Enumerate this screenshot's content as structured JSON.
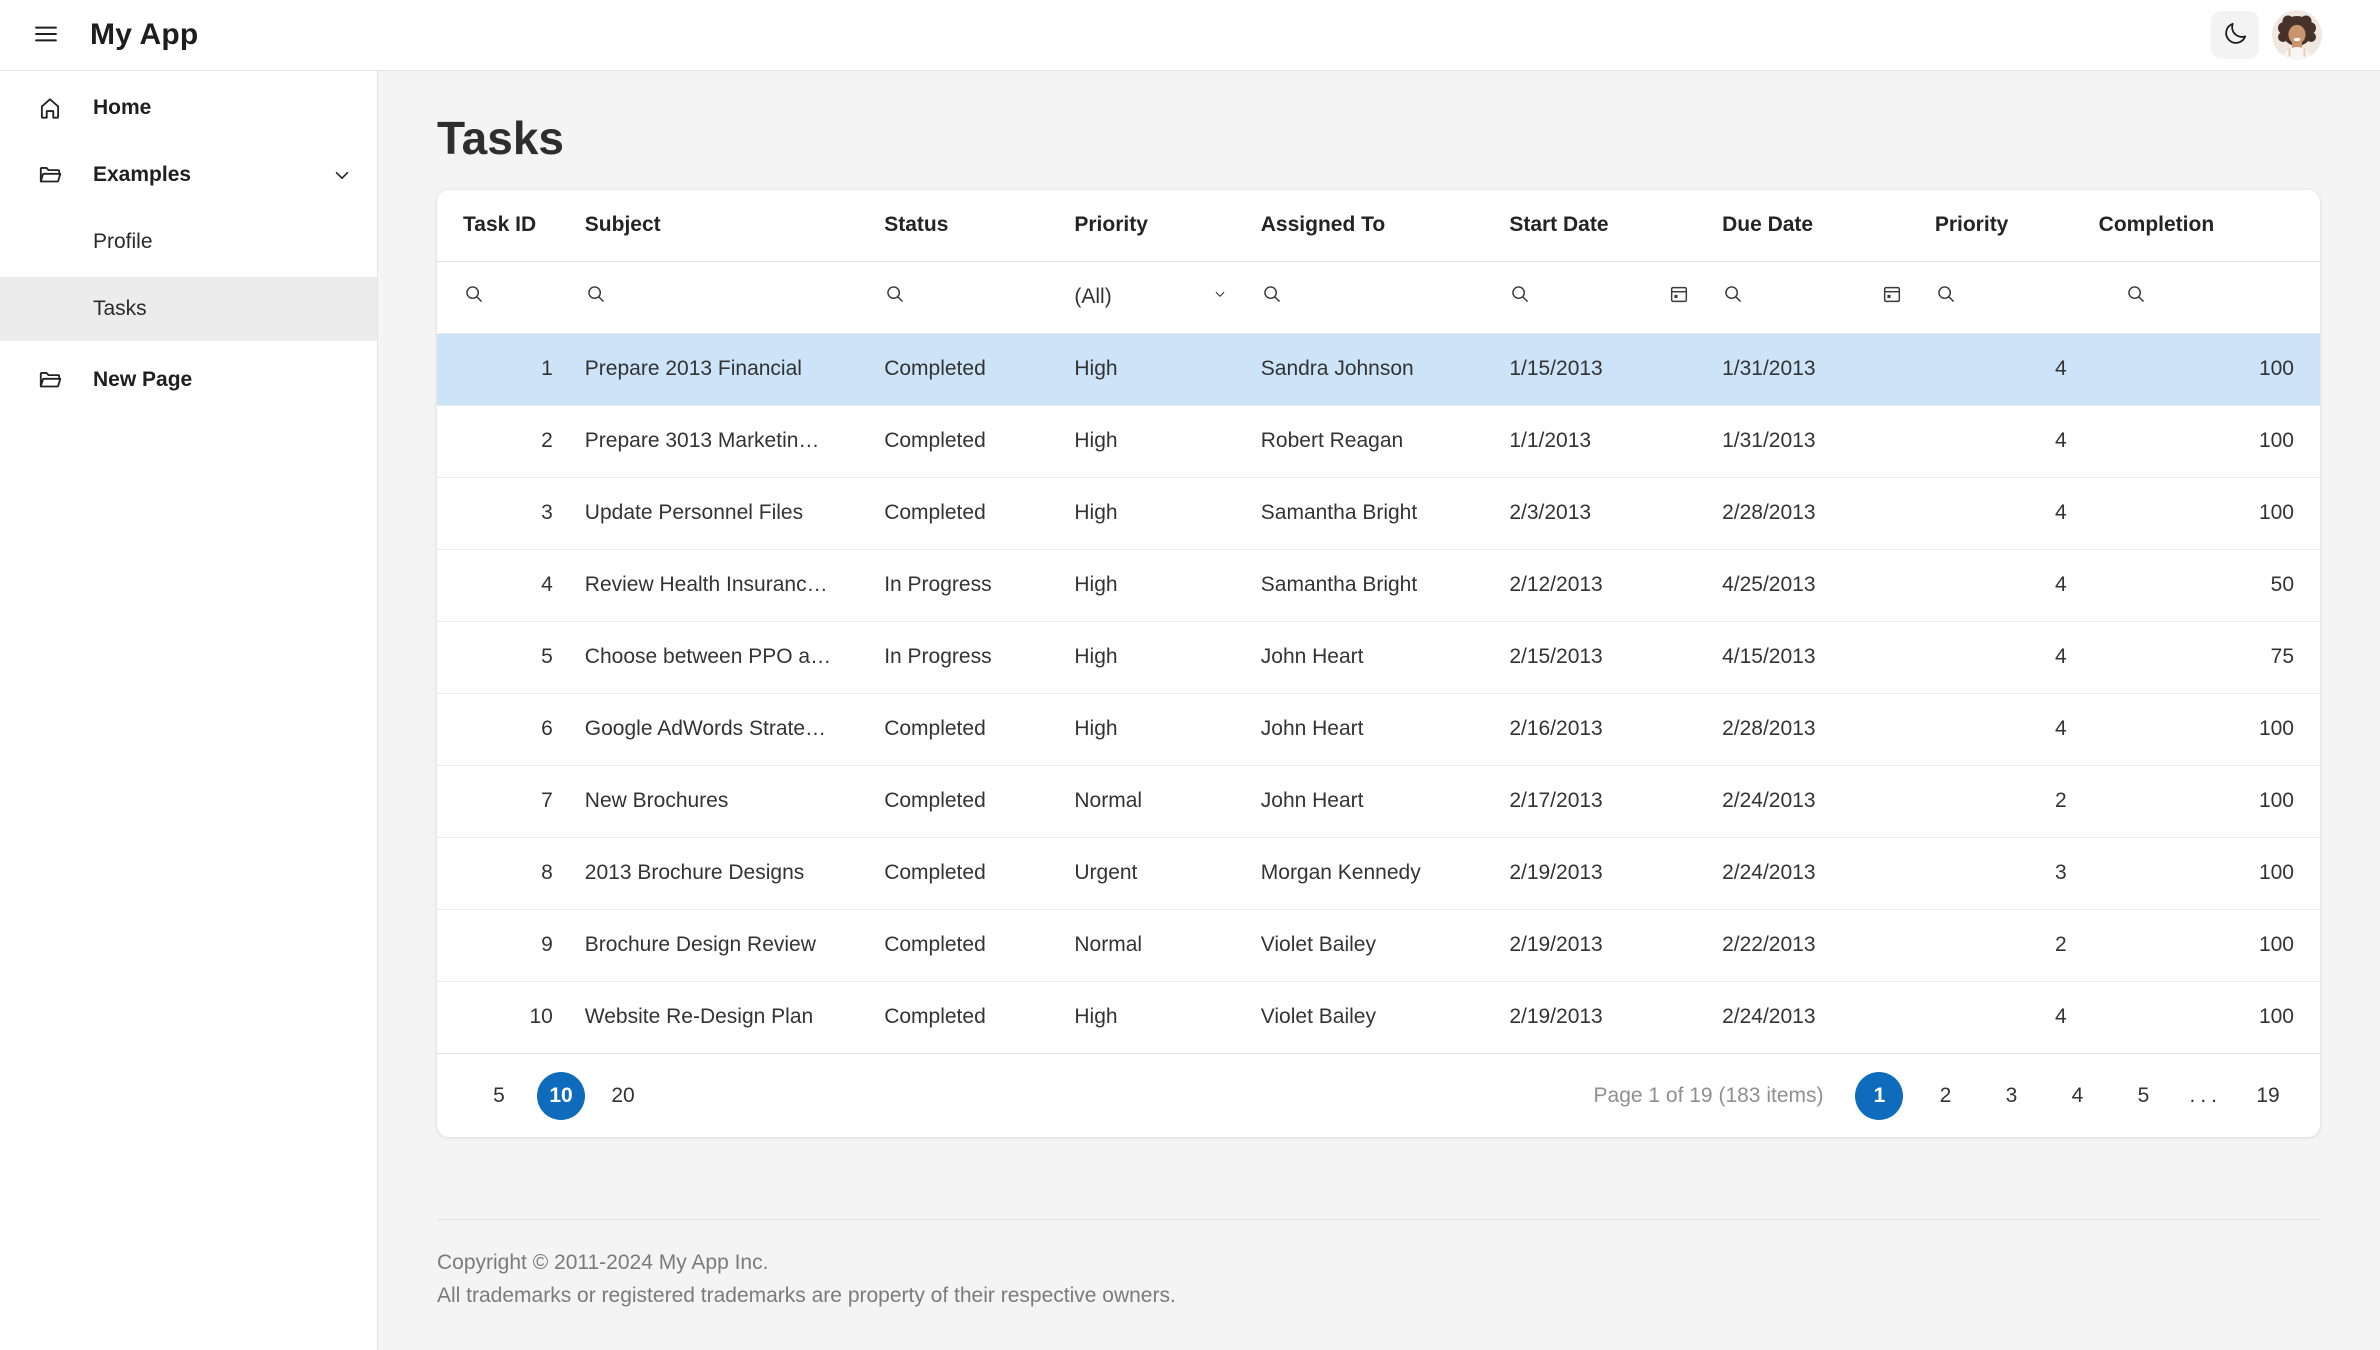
{
  "header": {
    "app_title": "My App"
  },
  "sidebar": {
    "items": [
      {
        "label": "Home",
        "icon": "home-icon",
        "bold": true
      },
      {
        "label": "Examples",
        "icon": "folder-open-icon",
        "bold": true,
        "expanded": true
      },
      {
        "label": "Profile",
        "sub": true
      },
      {
        "label": "Tasks",
        "sub": true,
        "selected": true
      },
      {
        "label": "New Page",
        "icon": "folder-open-icon",
        "bold": true
      }
    ]
  },
  "page": {
    "title": "Tasks"
  },
  "grid": {
    "columns": [
      {
        "key": "task_id",
        "label": "Task ID",
        "align": "right"
      },
      {
        "key": "subject",
        "label": "Subject",
        "align": "left"
      },
      {
        "key": "status",
        "label": "Status",
        "align": "left"
      },
      {
        "key": "priority",
        "label": "Priority",
        "align": "left"
      },
      {
        "key": "assigned_to",
        "label": "Assigned To",
        "align": "left"
      },
      {
        "key": "start_date",
        "label": "Start Date",
        "align": "left"
      },
      {
        "key": "due_date",
        "label": "Due Date",
        "align": "left"
      },
      {
        "key": "priority_num",
        "label": "Priority",
        "align": "right"
      },
      {
        "key": "completion",
        "label": "Completion",
        "align": "right"
      }
    ],
    "filter": {
      "priority_all": "(All)"
    },
    "rows": [
      {
        "task_id": "1",
        "subject": "Prepare 2013 Financial",
        "status": "Completed",
        "priority": "High",
        "assigned_to": "Sandra Johnson",
        "start_date": "1/15/2013",
        "due_date": "1/31/2013",
        "priority_num": "4",
        "completion": "100",
        "selected": true
      },
      {
        "task_id": "2",
        "subject": "Prepare 3013 Marketin…",
        "status": "Completed",
        "priority": "High",
        "assigned_to": "Robert Reagan",
        "start_date": "1/1/2013",
        "due_date": "1/31/2013",
        "priority_num": "4",
        "completion": "100"
      },
      {
        "task_id": "3",
        "subject": "Update Personnel Files",
        "status": "Completed",
        "priority": "High",
        "assigned_to": "Samantha Bright",
        "start_date": "2/3/2013",
        "due_date": "2/28/2013",
        "priority_num": "4",
        "completion": "100"
      },
      {
        "task_id": "4",
        "subject": "Review Health Insuranc…",
        "status": "In Progress",
        "priority": "High",
        "assigned_to": "Samantha Bright",
        "start_date": "2/12/2013",
        "due_date": "4/25/2013",
        "priority_num": "4",
        "completion": "50"
      },
      {
        "task_id": "5",
        "subject": "Choose between PPO a…",
        "status": "In Progress",
        "priority": "High",
        "assigned_to": "John Heart",
        "start_date": "2/15/2013",
        "due_date": "4/15/2013",
        "priority_num": "4",
        "completion": "75"
      },
      {
        "task_id": "6",
        "subject": "Google AdWords Strate…",
        "status": "Completed",
        "priority": "High",
        "assigned_to": "John Heart",
        "start_date": "2/16/2013",
        "due_date": "2/28/2013",
        "priority_num": "4",
        "completion": "100"
      },
      {
        "task_id": "7",
        "subject": "New Brochures",
        "status": "Completed",
        "priority": "Normal",
        "assigned_to": "John Heart",
        "start_date": "2/17/2013",
        "due_date": "2/24/2013",
        "priority_num": "2",
        "completion": "100"
      },
      {
        "task_id": "8",
        "subject": "2013 Brochure Designs",
        "status": "Completed",
        "priority": "Urgent",
        "assigned_to": "Morgan Kennedy",
        "start_date": "2/19/2013",
        "due_date": "2/24/2013",
        "priority_num": "3",
        "completion": "100"
      },
      {
        "task_id": "9",
        "subject": "Brochure Design Review",
        "status": "Completed",
        "priority": "Normal",
        "assigned_to": "Violet Bailey",
        "start_date": "2/19/2013",
        "due_date": "2/22/2013",
        "priority_num": "2",
        "completion": "100"
      },
      {
        "task_id": "10",
        "subject": "Website Re-Design Plan",
        "status": "Completed",
        "priority": "High",
        "assigned_to": "Violet Bailey",
        "start_date": "2/19/2013",
        "due_date": "2/24/2013",
        "priority_num": "4",
        "completion": "100"
      }
    ]
  },
  "pager": {
    "page_sizes": [
      "5",
      "10",
      "20"
    ],
    "selected_size": "10",
    "info": "Page 1 of 19 (183 items)",
    "pages": [
      "1",
      "2",
      "3",
      "4",
      "5",
      "...",
      "19"
    ],
    "current_page": "1"
  },
  "footer": {
    "line1": "Copyright © 2011-2024 My App Inc.",
    "line2": "All trademarks or registered trademarks are property of their respective owners."
  },
  "icons": {
    "menu": "hamburger-icon",
    "theme_toggle": "moon-icon",
    "filter_search": "search-icon",
    "date_picker": "calendar-icon",
    "tree_expand": "chevron-down-icon"
  },
  "colors": {
    "accent": "#0f6cbd",
    "selected_row": "#cce3f8",
    "sidebar_selected": "#ececec"
  }
}
